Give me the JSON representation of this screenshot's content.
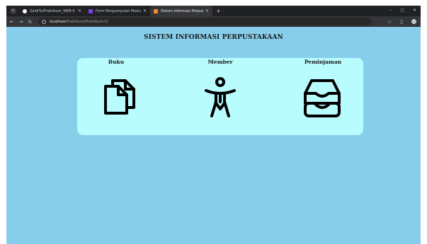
{
  "browser": {
    "tabs": [
      {
        "title": "ZaldiTu/Praktikum_WEB-II",
        "favicon": "github-icon"
      },
      {
        "title": "Form Pengumpulan Modul 5 (P...",
        "favicon": "form-icon"
      },
      {
        "title": "Sistem Informasi Perpustakaan",
        "favicon": "site-icon",
        "active": true
      }
    ],
    "address": {
      "host": "localhost",
      "path": "/Praktikum/Praktikum-5/"
    }
  },
  "page": {
    "title": "SISTEM INFORMASI PERPUSTAKAAN",
    "background": "#87ceeb",
    "panel_color": "#b8fcfe",
    "menu": [
      {
        "label": "Buku",
        "icon": "documents-icon"
      },
      {
        "label": "Member",
        "icon": "person-icon"
      },
      {
        "label": "Peminjaman",
        "icon": "inbox-tray-icon"
      }
    ]
  }
}
